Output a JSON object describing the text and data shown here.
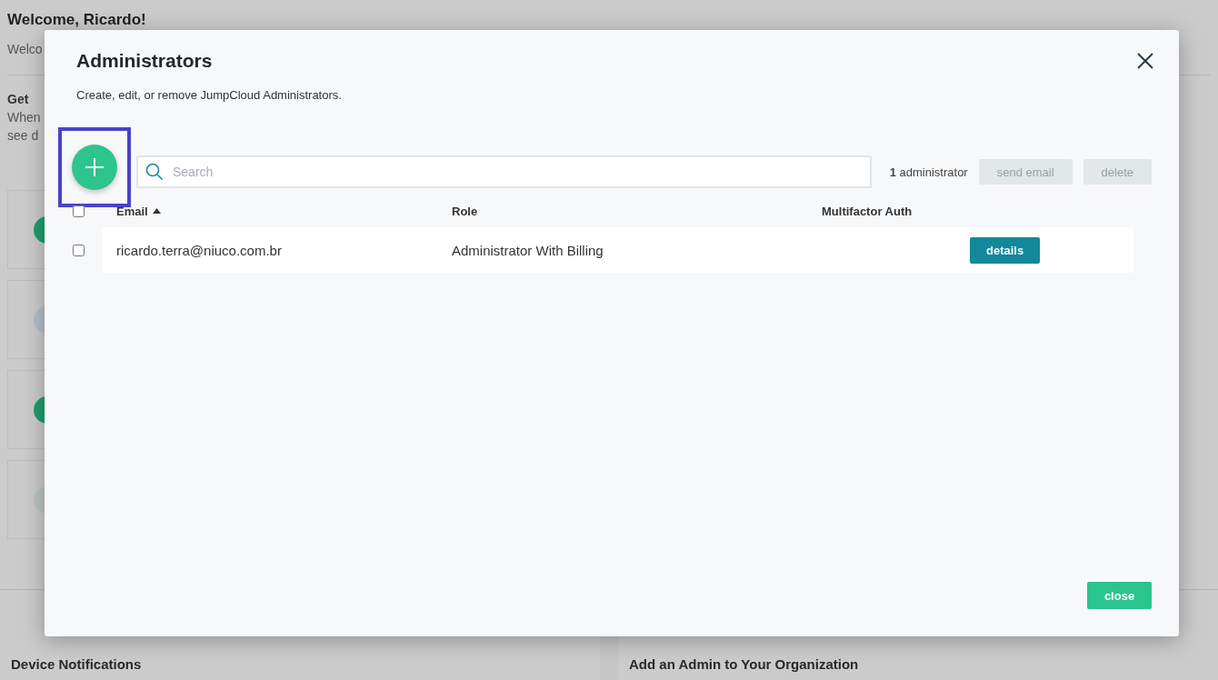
{
  "background": {
    "heading": "Welcome, Ricardo!",
    "intro": "Welco",
    "section_title": "Get",
    "section_lines": [
      "When",
      "see d"
    ],
    "cards": [
      {
        "color": "#1f9e6e"
      },
      {
        "color": "#b5c0c7"
      },
      {
        "color": "#1f9e6e"
      },
      {
        "color": "#b9c7c0"
      }
    ],
    "panels": [
      "Device Notifications",
      "Add an Admin to Your Organization"
    ]
  },
  "dialog": {
    "title": "Administrators",
    "subtitle": "Create, edit, or remove JumpCloud Administrators.",
    "add_button": {
      "highlighted": true
    },
    "search": {
      "placeholder": "Search"
    },
    "count": "**1** administrator",
    "actions": [
      {
        "label": "send email",
        "disabled": true
      },
      {
        "label": "delete",
        "disabled": true
      }
    ],
    "select_all": {
      "checked": false
    },
    "columns": [
      {
        "label": "Email",
        "sorted": true
      },
      {
        "label": "Role",
        "sorted": false
      },
      {
        "label": "Multifactor Auth",
        "sorted": false
      }
    ],
    "rows": [
      {
        "checked": false,
        "email": "ricardo.terra@niuco.com.br",
        "role": "Administrator With Billing",
        "action": "details"
      }
    ],
    "close_label": "close"
  }
}
